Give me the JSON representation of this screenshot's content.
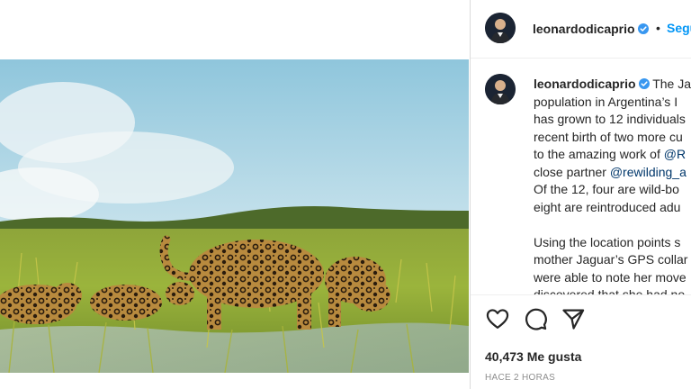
{
  "post": {
    "username": "leonardodicaprio",
    "follow_label": "Segu",
    "dot": "•",
    "caption_paragraphs": [
      [
        {
          "text": "The Ja"
        },
        {
          "text": "population in Argentina’s I"
        },
        {
          "text": "has grown to 12 individuals"
        },
        {
          "text": "recent birth of two more cu"
        },
        {
          "text": "to the amazing work of "
        },
        {
          "text": "@R",
          "link": true
        },
        {
          "text": "close partner "
        },
        {
          "text": "@rewilding_a",
          "link": true
        },
        {
          "text": "Of the 12, four are wild-bo"
        },
        {
          "text": "eight are reintroduced adu"
        }
      ],
      [
        {
          "text": "Using the location points s"
        },
        {
          "text": "mother Jaguar’s GPS collar"
        },
        {
          "text": "were able to note her move"
        },
        {
          "text": "discovered that she had no"
        }
      ]
    ],
    "likes_text": "40,473 Me gusta",
    "time_text": "HACE 2 HORAS"
  },
  "colors": {
    "follow_blue": "#0095f6",
    "verified_blue": "#3897f0",
    "link_color": "#00376b",
    "muted_text": "#8e8e8e"
  },
  "icons": {
    "like": "heart-icon",
    "comment": "comment-icon",
    "share": "paper-plane-icon",
    "verified": "verified-badge-icon"
  }
}
